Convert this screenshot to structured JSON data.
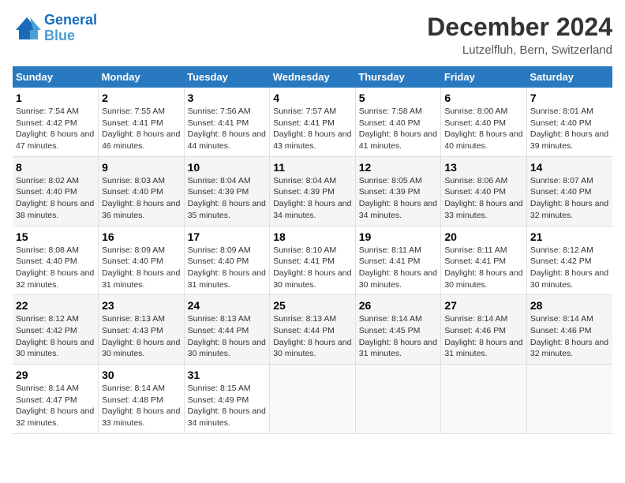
{
  "logo": {
    "line1": "General",
    "line2": "Blue"
  },
  "title": "December 2024",
  "subtitle": "Lutzelfluh, Bern, Switzerland",
  "headers": [
    "Sunday",
    "Monday",
    "Tuesday",
    "Wednesday",
    "Thursday",
    "Friday",
    "Saturday"
  ],
  "weeks": [
    [
      {
        "day": "1",
        "sunrise": "Sunrise: 7:54 AM",
        "sunset": "Sunset: 4:42 PM",
        "daylight": "Daylight: 8 hours and 47 minutes."
      },
      {
        "day": "2",
        "sunrise": "Sunrise: 7:55 AM",
        "sunset": "Sunset: 4:41 PM",
        "daylight": "Daylight: 8 hours and 46 minutes."
      },
      {
        "day": "3",
        "sunrise": "Sunrise: 7:56 AM",
        "sunset": "Sunset: 4:41 PM",
        "daylight": "Daylight: 8 hours and 44 minutes."
      },
      {
        "day": "4",
        "sunrise": "Sunrise: 7:57 AM",
        "sunset": "Sunset: 4:41 PM",
        "daylight": "Daylight: 8 hours and 43 minutes."
      },
      {
        "day": "5",
        "sunrise": "Sunrise: 7:58 AM",
        "sunset": "Sunset: 4:40 PM",
        "daylight": "Daylight: 8 hours and 41 minutes."
      },
      {
        "day": "6",
        "sunrise": "Sunrise: 8:00 AM",
        "sunset": "Sunset: 4:40 PM",
        "daylight": "Daylight: 8 hours and 40 minutes."
      },
      {
        "day": "7",
        "sunrise": "Sunrise: 8:01 AM",
        "sunset": "Sunset: 4:40 PM",
        "daylight": "Daylight: 8 hours and 39 minutes."
      }
    ],
    [
      {
        "day": "8",
        "sunrise": "Sunrise: 8:02 AM",
        "sunset": "Sunset: 4:40 PM",
        "daylight": "Daylight: 8 hours and 38 minutes."
      },
      {
        "day": "9",
        "sunrise": "Sunrise: 8:03 AM",
        "sunset": "Sunset: 4:40 PM",
        "daylight": "Daylight: 8 hours and 36 minutes."
      },
      {
        "day": "10",
        "sunrise": "Sunrise: 8:04 AM",
        "sunset": "Sunset: 4:39 PM",
        "daylight": "Daylight: 8 hours and 35 minutes."
      },
      {
        "day": "11",
        "sunrise": "Sunrise: 8:04 AM",
        "sunset": "Sunset: 4:39 PM",
        "daylight": "Daylight: 8 hours and 34 minutes."
      },
      {
        "day": "12",
        "sunrise": "Sunrise: 8:05 AM",
        "sunset": "Sunset: 4:39 PM",
        "daylight": "Daylight: 8 hours and 34 minutes."
      },
      {
        "day": "13",
        "sunrise": "Sunrise: 8:06 AM",
        "sunset": "Sunset: 4:40 PM",
        "daylight": "Daylight: 8 hours and 33 minutes."
      },
      {
        "day": "14",
        "sunrise": "Sunrise: 8:07 AM",
        "sunset": "Sunset: 4:40 PM",
        "daylight": "Daylight: 8 hours and 32 minutes."
      }
    ],
    [
      {
        "day": "15",
        "sunrise": "Sunrise: 8:08 AM",
        "sunset": "Sunset: 4:40 PM",
        "daylight": "Daylight: 8 hours and 32 minutes."
      },
      {
        "day": "16",
        "sunrise": "Sunrise: 8:09 AM",
        "sunset": "Sunset: 4:40 PM",
        "daylight": "Daylight: 8 hours and 31 minutes."
      },
      {
        "day": "17",
        "sunrise": "Sunrise: 8:09 AM",
        "sunset": "Sunset: 4:40 PM",
        "daylight": "Daylight: 8 hours and 31 minutes."
      },
      {
        "day": "18",
        "sunrise": "Sunrise: 8:10 AM",
        "sunset": "Sunset: 4:41 PM",
        "daylight": "Daylight: 8 hours and 30 minutes."
      },
      {
        "day": "19",
        "sunrise": "Sunrise: 8:11 AM",
        "sunset": "Sunset: 4:41 PM",
        "daylight": "Daylight: 8 hours and 30 minutes."
      },
      {
        "day": "20",
        "sunrise": "Sunrise: 8:11 AM",
        "sunset": "Sunset: 4:41 PM",
        "daylight": "Daylight: 8 hours and 30 minutes."
      },
      {
        "day": "21",
        "sunrise": "Sunrise: 8:12 AM",
        "sunset": "Sunset: 4:42 PM",
        "daylight": "Daylight: 8 hours and 30 minutes."
      }
    ],
    [
      {
        "day": "22",
        "sunrise": "Sunrise: 8:12 AM",
        "sunset": "Sunset: 4:42 PM",
        "daylight": "Daylight: 8 hours and 30 minutes."
      },
      {
        "day": "23",
        "sunrise": "Sunrise: 8:13 AM",
        "sunset": "Sunset: 4:43 PM",
        "daylight": "Daylight: 8 hours and 30 minutes."
      },
      {
        "day": "24",
        "sunrise": "Sunrise: 8:13 AM",
        "sunset": "Sunset: 4:44 PM",
        "daylight": "Daylight: 8 hours and 30 minutes."
      },
      {
        "day": "25",
        "sunrise": "Sunrise: 8:13 AM",
        "sunset": "Sunset: 4:44 PM",
        "daylight": "Daylight: 8 hours and 30 minutes."
      },
      {
        "day": "26",
        "sunrise": "Sunrise: 8:14 AM",
        "sunset": "Sunset: 4:45 PM",
        "daylight": "Daylight: 8 hours and 31 minutes."
      },
      {
        "day": "27",
        "sunrise": "Sunrise: 8:14 AM",
        "sunset": "Sunset: 4:46 PM",
        "daylight": "Daylight: 8 hours and 31 minutes."
      },
      {
        "day": "28",
        "sunrise": "Sunrise: 8:14 AM",
        "sunset": "Sunset: 4:46 PM",
        "daylight": "Daylight: 8 hours and 32 minutes."
      }
    ],
    [
      {
        "day": "29",
        "sunrise": "Sunrise: 8:14 AM",
        "sunset": "Sunset: 4:47 PM",
        "daylight": "Daylight: 8 hours and 32 minutes."
      },
      {
        "day": "30",
        "sunrise": "Sunrise: 8:14 AM",
        "sunset": "Sunset: 4:48 PM",
        "daylight": "Daylight: 8 hours and 33 minutes."
      },
      {
        "day": "31",
        "sunrise": "Sunrise: 8:15 AM",
        "sunset": "Sunset: 4:49 PM",
        "daylight": "Daylight: 8 hours and 34 minutes."
      },
      null,
      null,
      null,
      null
    ]
  ]
}
